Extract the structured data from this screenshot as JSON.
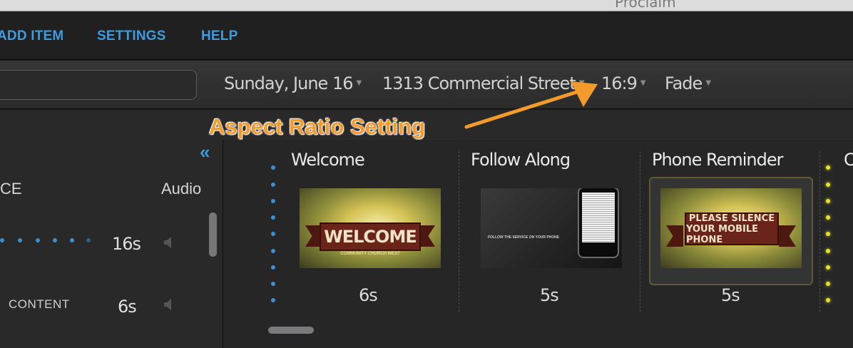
{
  "window": {
    "title": "Proclaim"
  },
  "menu": {
    "add_item": "ADD ITEM",
    "settings": "SETTINGS",
    "help": "HELP"
  },
  "toolbar": {
    "search_value": "",
    "date": "Sunday, June 16",
    "location": "1313 Commercial Street",
    "aspect_ratio": "16:9",
    "transition": "Fade"
  },
  "annotation": {
    "text": "Aspect Ratio Setting"
  },
  "left_panel": {
    "header_left": "CE",
    "header_audio": "Audio",
    "rows": [
      {
        "label": "",
        "duration": "16s"
      },
      {
        "label": "CONTENT",
        "duration": "6s"
      }
    ]
  },
  "slides": [
    {
      "title": "Welcome",
      "duration": "6s",
      "banner": "WELCOME",
      "banner_sub": "COMMUNITY CHURCH WEST"
    },
    {
      "title": "Follow Along",
      "duration": "5s",
      "thumb_text": "FOLLOW THE SERVICE ON YOUR PHONE"
    },
    {
      "title": "Phone Reminder",
      "duration": "5s",
      "banner_line1": "PLEASE SILENCE",
      "banner_line2": "YOUR MOBILE PHONE"
    },
    {
      "title": "C"
    }
  ],
  "colors": {
    "accent": "#3d9be0",
    "annotation": "#f39a2d",
    "selected": "#e7e033"
  }
}
